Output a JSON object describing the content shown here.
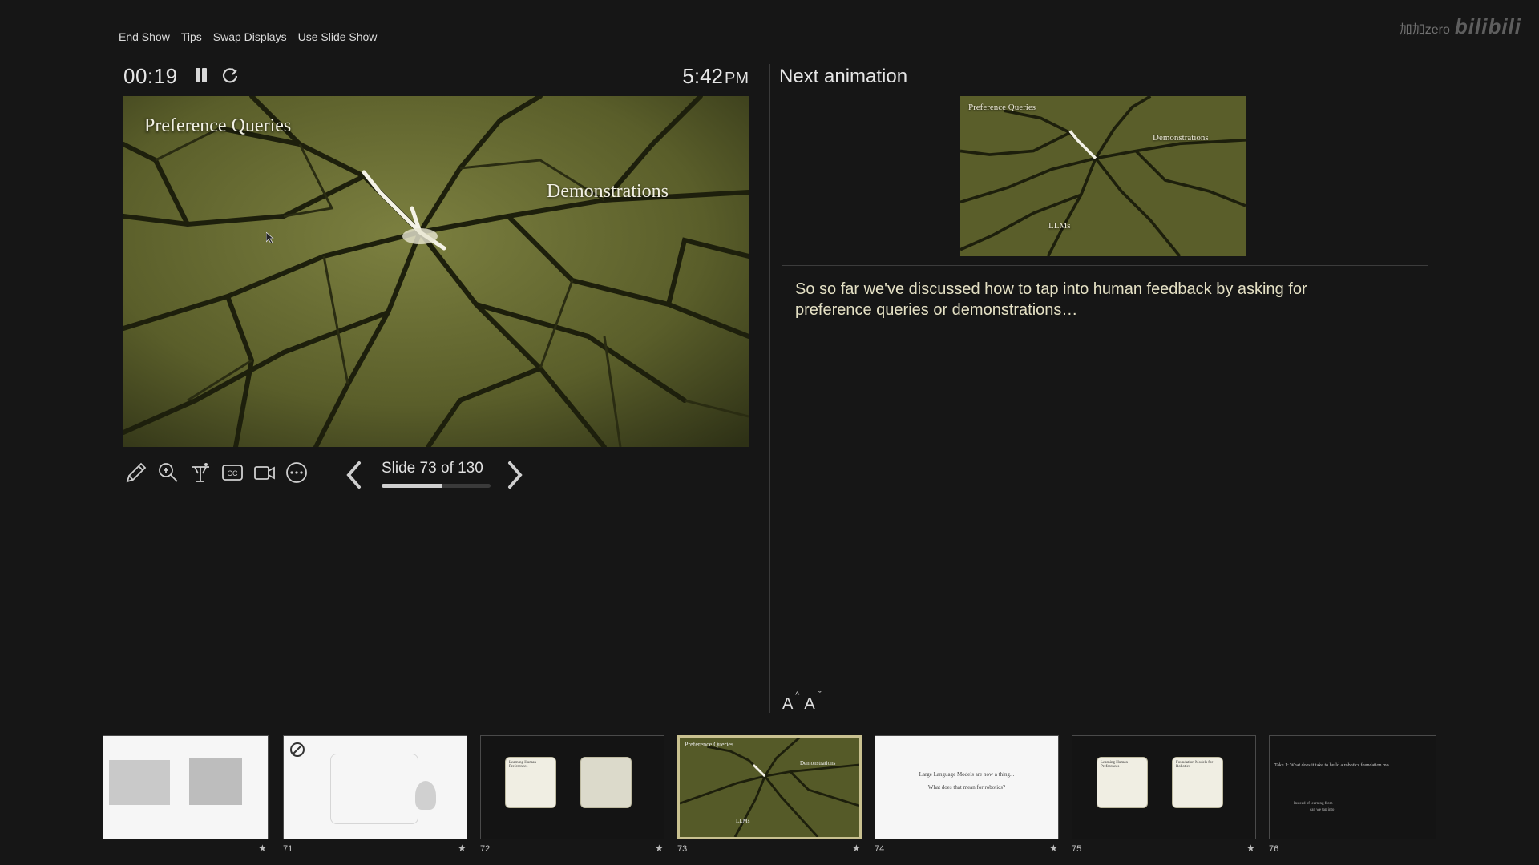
{
  "menu": {
    "end_show": "End Show",
    "tips": "Tips",
    "swap_displays": "Swap Displays",
    "use_slide_show": "Use Slide Show"
  },
  "watermark": {
    "text": "加加zero",
    "logo": "bilibili"
  },
  "presenter": {
    "elapsed": "00:19",
    "clock_time": "5:42",
    "clock_ampm": "PM"
  },
  "current_slide": {
    "title": "Preference Queries",
    "label": "Demonstrations"
  },
  "toolbar": {
    "icons": [
      "pencil-icon",
      "zoom-icon",
      "pointer-icon",
      "captions-icon",
      "camera-icon",
      "more-icon"
    ]
  },
  "navigation": {
    "counter": "Slide 73 of 130",
    "current": 73,
    "total": 130
  },
  "next": {
    "heading": "Next animation",
    "slide_title": "Preference Queries",
    "slide_label_1": "Demonstrations",
    "slide_label_2": "LLMs"
  },
  "notes": {
    "text": "So so far we've discussed how to tap into human feedback by asking for preference queries or demonstrations…"
  },
  "font_controls": {
    "increase": "A",
    "decrease": "A"
  },
  "thumbnails": [
    {
      "num": "",
      "style": "white"
    },
    {
      "num": "71",
      "style": "white"
    },
    {
      "num": "72",
      "style": "dark",
      "card_title": "Learning Human Preferences"
    },
    {
      "num": "73",
      "style": "olive",
      "active": true,
      "title": "Preference Queries",
      "label_1": "Demonstrations",
      "label_2": "LLMs"
    },
    {
      "num": "74",
      "style": "white",
      "line_1": "Large Language Models are now a thing...",
      "line_2": "What does that mean for robotics?"
    },
    {
      "num": "75",
      "style": "dark",
      "card_title": "Learning Human Preferences",
      "card_title_2": "Foundation Models for Robotics"
    },
    {
      "num": "76",
      "style": "dark",
      "line_1": "Take 1: What does it take to build a robotics foundation mo",
      "line_2": "Instead of learning from",
      "line_3": "can we tap into"
    }
  ],
  "colors": {
    "background": "#161616",
    "active_border": "#c9c190",
    "notes_text": "#e4e0c4"
  }
}
